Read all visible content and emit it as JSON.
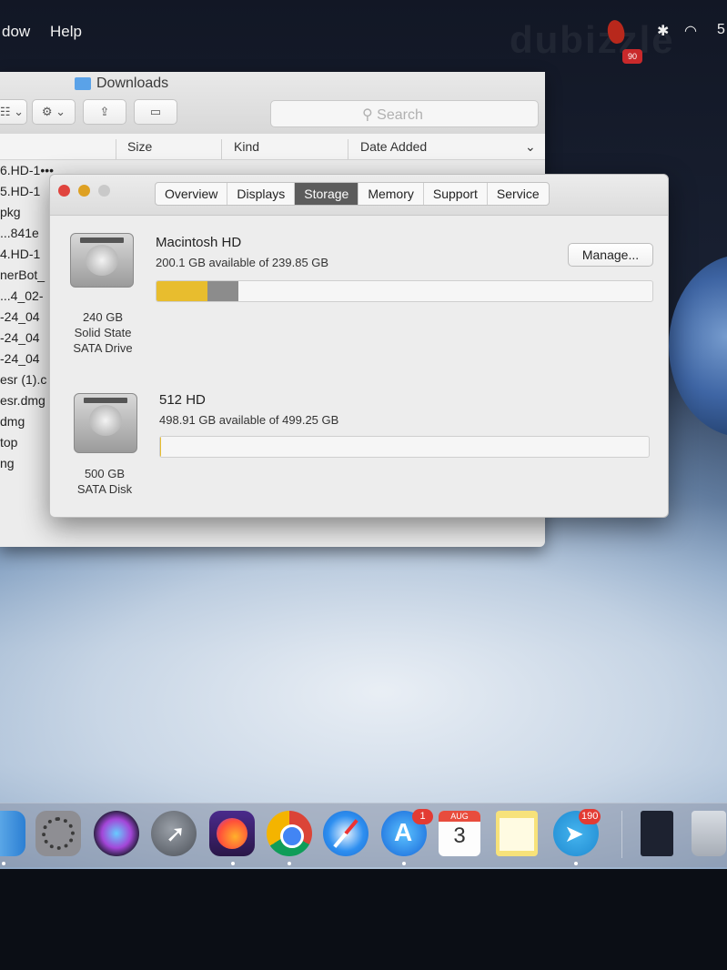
{
  "menubar": {
    "items": [
      "dow",
      "Help"
    ],
    "status_badge": "90",
    "clock_fragment": "5"
  },
  "finder": {
    "title": "Downloads",
    "search_placeholder": "Search",
    "columns": [
      "Size",
      "Kind",
      "Date Added"
    ],
    "rows": [
      "6.HD-1•••",
      "5.HD-1",
      "pkg",
      "...841e",
      "4.HD-1",
      "nerBot_",
      "...4_02-",
      "-24_04",
      "-24_04",
      "-24_04",
      "esr (1).c",
      "esr.dmg",
      "dmg",
      "top",
      "ng"
    ]
  },
  "about": {
    "tabs": [
      "Overview",
      "Displays",
      "Storage",
      "Memory",
      "Support",
      "Service"
    ],
    "active_tab": "Storage",
    "manage_label": "Manage...",
    "drives": [
      {
        "name": "Macintosh HD",
        "available": "200.1 GB available of 239.85 GB",
        "cap_line1": "240 GB",
        "cap_line2": "Solid State",
        "cap_line3": "SATA Drive",
        "used_fraction": 0.166
      },
      {
        "name": "512 HD",
        "available": "498.91 GB available of 499.25 GB",
        "cap_line1": "500 GB",
        "cap_line2": "SATA Disk",
        "used_fraction": 0.001
      }
    ]
  },
  "dock": {
    "app_store_badge": "1",
    "calendar_month": "AUG",
    "calendar_day": "3",
    "telegram_badge": "190"
  },
  "colors": {
    "storage_fill": "#e8bd2e",
    "active_tab": "#5c5c5c",
    "close": "#e0443e",
    "minimize": "#dea123",
    "zoom": "#c9c9c9"
  }
}
